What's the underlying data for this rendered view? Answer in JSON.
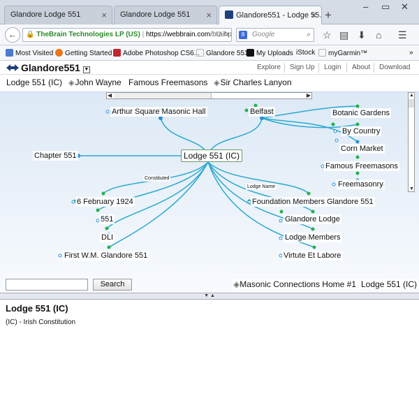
{
  "browser": {
    "tabs": [
      {
        "label": "Glandore Lodge 551"
      },
      {
        "label": "Glandore Lodge 551"
      },
      {
        "label": "Glandore551 - Lodge 55..."
      }
    ],
    "url": {
      "identity": "TheBrain Technologies LP (US)",
      "host": "https://webbrain.com",
      "path": "/brainpa"
    },
    "search_placeholder": "Google",
    "bookmarks": [
      {
        "label": "Most Visited"
      },
      {
        "label": "Getting Started"
      },
      {
        "label": "Adobe Photoshop CS6..."
      },
      {
        "label": "Glandore 551"
      },
      {
        "label": "My Uploads"
      },
      {
        "label": "iStock"
      },
      {
        "label": "myGarmin™"
      }
    ],
    "more_bookmarks": "»"
  },
  "app": {
    "brain_name": "Glandore551",
    "menu": [
      {
        "label": "Explore"
      },
      {
        "label": "Sign Up"
      },
      {
        "label": "Login"
      },
      {
        "label": "About"
      },
      {
        "label": "Download"
      }
    ]
  },
  "pins": [
    {
      "label": "Lodge 551 (IC)"
    },
    {
      "label": "John Wayne"
    },
    {
      "label": "Famous Freemasons"
    },
    {
      "label": "Sir Charles Lanyon"
    }
  ],
  "plex": {
    "active": "Lodge 551 (IC)",
    "parents": [
      "Arthur Square Masonic Hall",
      "Belfast"
    ],
    "jumps": [
      "Chapter 551"
    ],
    "siblings": [
      "Botanic Gardens",
      "By Country",
      "Corn Market",
      "Famous Freemasons",
      "Freemasonry"
    ],
    "children_left": [
      "6 February 1924",
      "551",
      "DLI",
      "First W.M. Glandore 551"
    ],
    "children_right": [
      "Foundation Members Glandore 551",
      "Glandore Lodge",
      "Lodge Members",
      "Virtute Et Labore"
    ],
    "link_labels": [
      "Constituted",
      "Lodge Name"
    ]
  },
  "search": {
    "button": "Search",
    "value": ""
  },
  "bottom_crumbs": [
    {
      "label": "Masonic Connections Home #1"
    },
    {
      "label": "Lodge 551 (IC)"
    }
  ],
  "notes": {
    "title": "Lodge 551 (IC)",
    "body": "(IC) - Irish Constitution"
  },
  "colors": {
    "link": "#2aa9cf",
    "dot_green": "#22b14c",
    "dot_blue": "#2a8fd6",
    "canvas_top": "#dce9f6"
  }
}
